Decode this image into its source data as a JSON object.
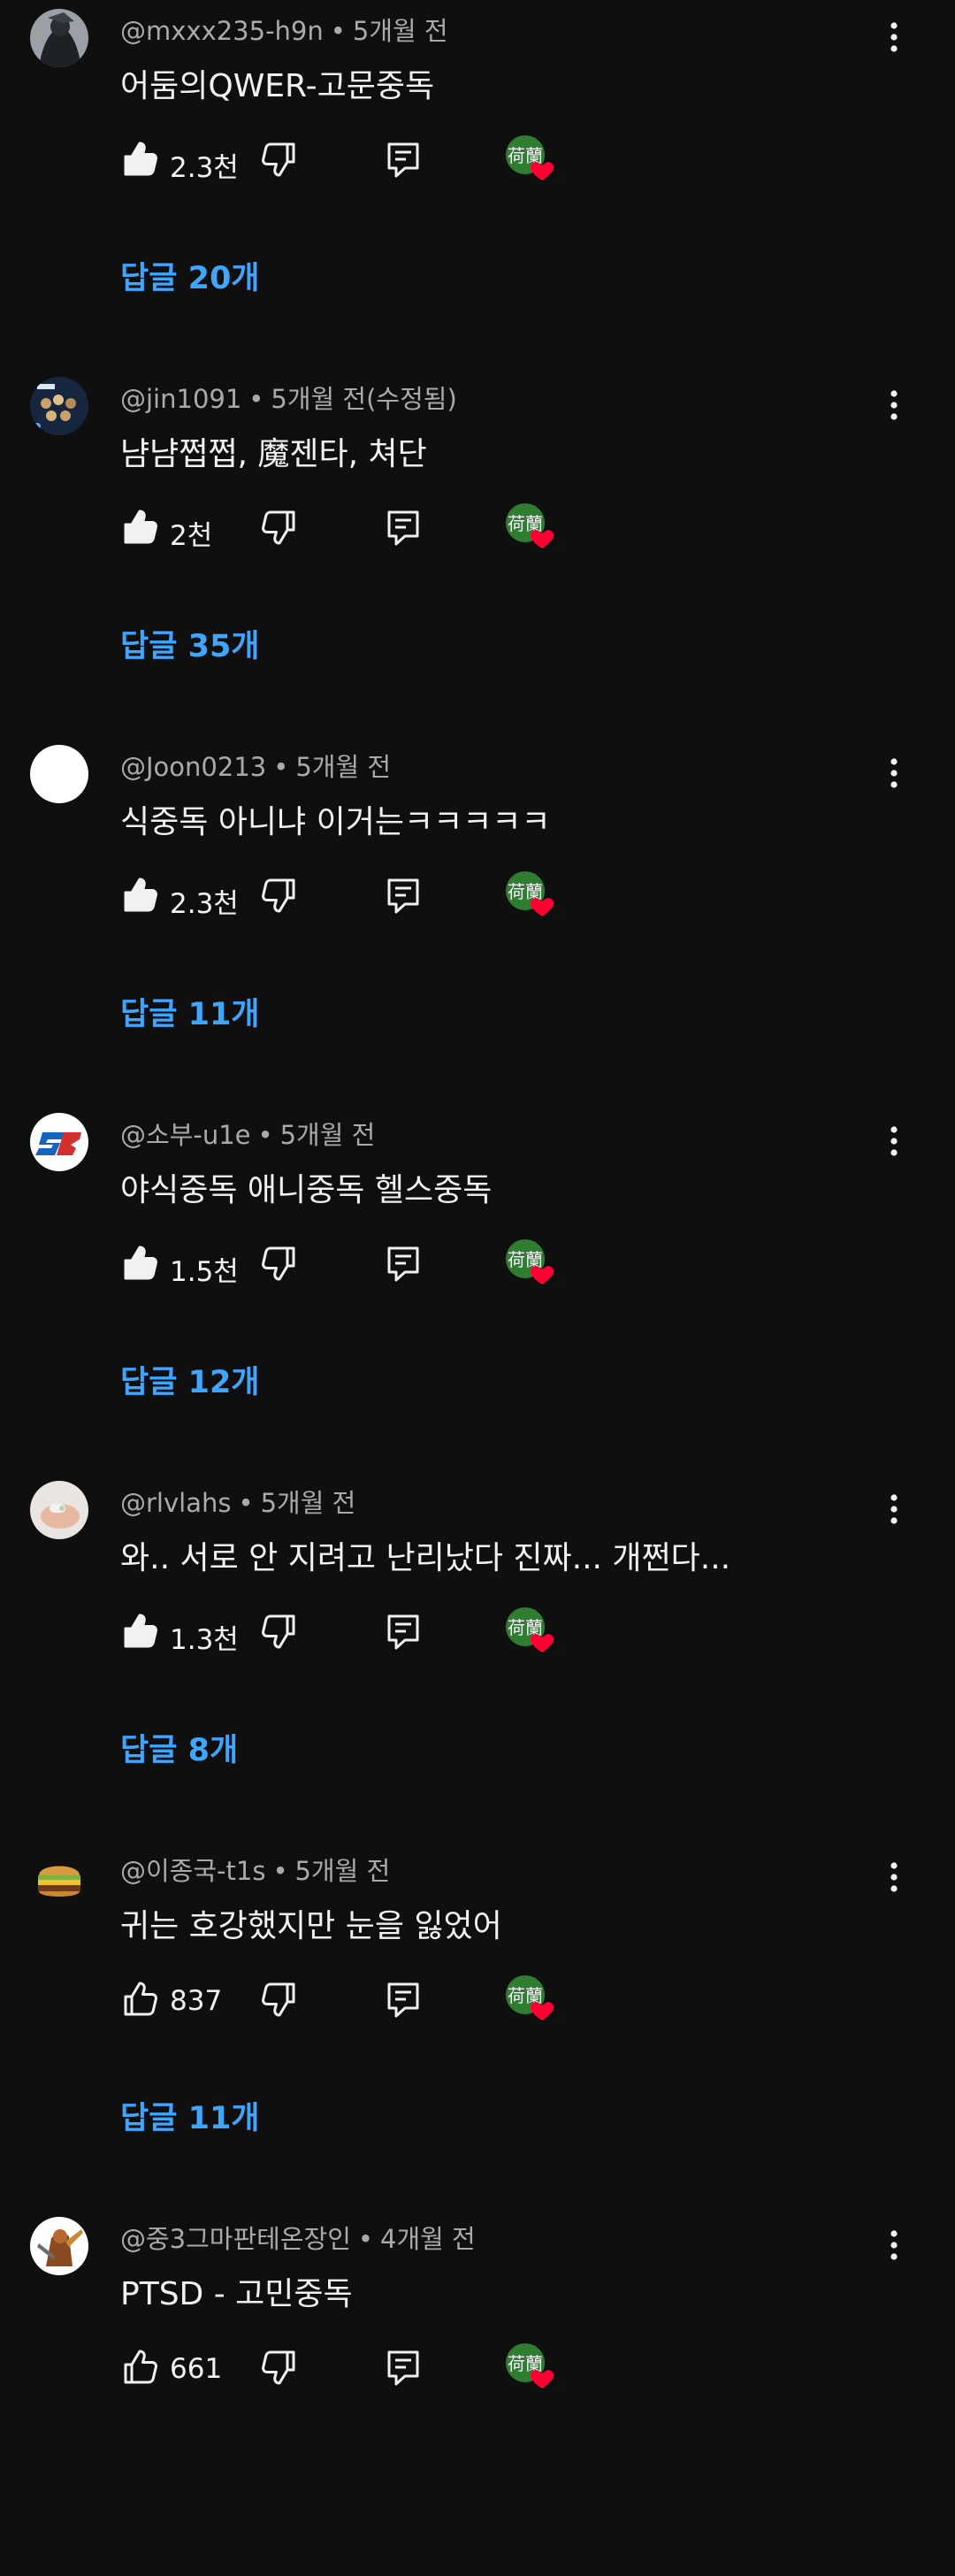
{
  "comments": [
    {
      "handle": "@mxxx235-h9n",
      "time": "5개월 전",
      "text": "어둠의QWER-고문중독",
      "likes": "2.3천",
      "liked": true,
      "replies": "답글 20개",
      "avatar": "dark-character-avatar"
    },
    {
      "handle": "@jin1091",
      "time": "5개월 전(수정됨)",
      "text": "냠냠쩝쩝, 魔젠타, 쳐단",
      "likes": "2천",
      "liked": true,
      "replies": "답글 35개",
      "avatar": "album-cover-avatar"
    },
    {
      "handle": "@Joon0213",
      "time": "5개월 전",
      "text": "식중독 아니냐 이거는ㅋㅋㅋㅋㅋ",
      "likes": "2.3천",
      "liked": true,
      "replies": "답글 11개",
      "avatar": "white-circle-avatar"
    },
    {
      "handle": "@소부-u1e",
      "time": "5개월 전",
      "text": "야식중독 애니중독 헬스중독",
      "likes": "1.5천",
      "liked": true,
      "replies": "답글 12개",
      "avatar": "sb-logo-avatar"
    },
    {
      "handle": "@rlvlahs",
      "time": "5개월 전",
      "text": "와.. 서로 안 지려고 난리났다 진짜... 개쩐다...",
      "likes": "1.3천",
      "liked": true,
      "replies": "답글 8개",
      "avatar": "hand-photo-avatar"
    },
    {
      "handle": "@이종국-t1s",
      "time": "5개월 전",
      "text": "귀는 호강했지만 눈을 잃었어",
      "likes": "837",
      "liked": false,
      "replies": "답글 11개",
      "avatar": "burger-avatar"
    },
    {
      "handle": "@중3그마판테온장인",
      "time": "4개월 전",
      "text": "PTSD - 고민중독",
      "likes": "661",
      "liked": false,
      "replies": "",
      "avatar": "warrior-avatar"
    }
  ],
  "creator_heart_badge_text": "荷蘭",
  "colors": {
    "background": "#0f0f0f",
    "text_primary": "#f1f1f1",
    "text_secondary": "#aaaaaa",
    "link_blue": "#3ea6ff",
    "heart_red": "#ff0033",
    "badge_green": "#2e7d32"
  }
}
